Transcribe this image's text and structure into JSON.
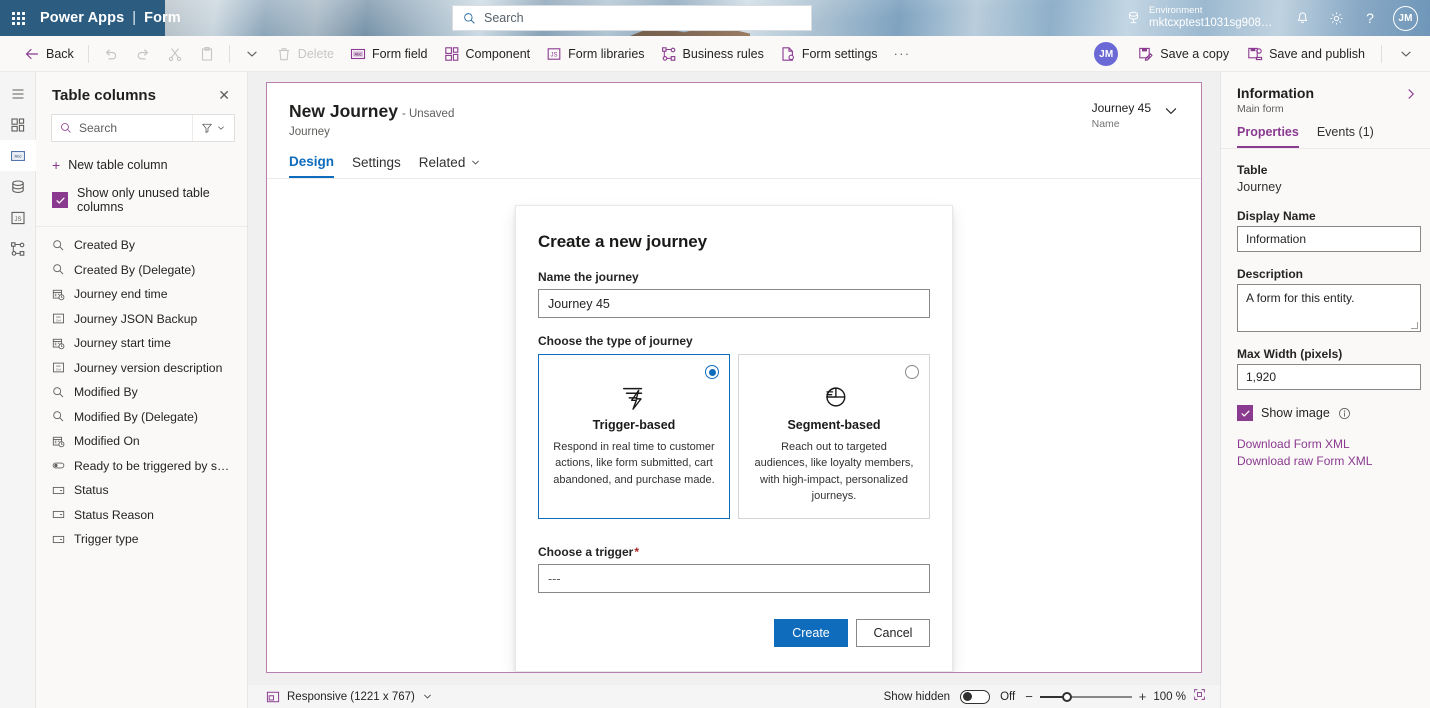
{
  "suitebar": {
    "waffle": "app-launcher",
    "brand": "Power Apps",
    "separator": "|",
    "app_name": "Form",
    "search_placeholder": "Search",
    "environment_label": "Environment",
    "environment_value": "mktcxptest1031sg908m...",
    "user_initials": "JM"
  },
  "commandbar": {
    "back": "Back",
    "delete": "Delete",
    "form_field": "Form field",
    "component": "Component",
    "form_libraries": "Form libraries",
    "business_rules": "Business rules",
    "form_settings": "Form settings",
    "overflow": "···",
    "user_initials": "JM",
    "save_a_copy": "Save a copy",
    "save_and_publish": "Save and publish"
  },
  "rail": {
    "items": [
      {
        "name": "hamburger-menu-icon"
      },
      {
        "name": "components-icon"
      },
      {
        "name": "table-columns-icon"
      },
      {
        "name": "data-sources-icon"
      },
      {
        "name": "form-libraries-icon"
      },
      {
        "name": "business-rules-icon"
      }
    ]
  },
  "left_panel": {
    "title": "Table columns",
    "close": "✕",
    "search_placeholder": "Search",
    "new_table_column": "New table column",
    "show_only_unused": "Show only unused table columns",
    "show_only_unused_checked": true,
    "columns": [
      {
        "label": "Created By",
        "icon": "lookup-icon"
      },
      {
        "label": "Created By (Delegate)",
        "icon": "lookup-icon"
      },
      {
        "label": "Journey end time",
        "icon": "datetime-icon"
      },
      {
        "label": "Journey JSON Backup",
        "icon": "multiline-text-icon"
      },
      {
        "label": "Journey start time",
        "icon": "datetime-icon"
      },
      {
        "label": "Journey version description",
        "icon": "multiline-text-icon"
      },
      {
        "label": "Modified By",
        "icon": "lookup-icon"
      },
      {
        "label": "Modified By (Delegate)",
        "icon": "lookup-icon"
      },
      {
        "label": "Modified On",
        "icon": "datetime-icon"
      },
      {
        "label": "Ready to be triggered by segment r...",
        "icon": "toggle-icon"
      },
      {
        "label": "Status",
        "icon": "choice-icon"
      },
      {
        "label": "Status Reason",
        "icon": "choice-icon"
      },
      {
        "label": "Trigger type",
        "icon": "choice-icon"
      }
    ]
  },
  "form_header": {
    "title": "New Journey",
    "unsaved": "- Unsaved",
    "table": "Journey",
    "record_value": "Journey 45",
    "record_label": "Name",
    "tabs": [
      {
        "label": "Design",
        "active": true,
        "chevron": false
      },
      {
        "label": "Settings",
        "active": false,
        "chevron": false
      },
      {
        "label": "Related",
        "active": false,
        "chevron": true
      }
    ]
  },
  "modal": {
    "heading": "Create a new journey",
    "name_label": "Name the journey",
    "name_value": "Journey 45",
    "type_label": "Choose the type of journey",
    "cards": [
      {
        "title": "Trigger-based",
        "description": "Respond in real time to customer actions, like form submitted, cart abandoned, and purchase made.",
        "selected": true,
        "icon": "trigger-bolt-icon"
      },
      {
        "title": "Segment-based",
        "description": "Reach out to targeted audiences, like loyalty members, with high-impact, personalized journeys.",
        "selected": false,
        "icon": "segment-pie-icon"
      }
    ],
    "trigger_label": "Choose a trigger",
    "trigger_required": "*",
    "trigger_value": "---",
    "create_button": "Create",
    "cancel_button": "Cancel"
  },
  "right_panel": {
    "title": "Information",
    "subtitle": "Main form",
    "tabs": [
      {
        "label": "Properties",
        "active": true
      },
      {
        "label": "Events (1)",
        "active": false
      }
    ],
    "table_label": "Table",
    "table_value": "Journey",
    "display_name_label": "Display Name",
    "display_name_value": "Information",
    "description_label": "Description",
    "description_value": "A form for this entity.",
    "max_width_label": "Max Width (pixels)",
    "max_width_value": "1,920",
    "show_image_label": "Show image",
    "show_image_checked": true,
    "download_form_xml": "Download Form XML",
    "download_raw_form_xml": "Download raw Form XML"
  },
  "statusbar": {
    "responsive": "Responsive (1221 x 767)",
    "show_hidden_label": "Show hidden",
    "show_hidden_state": "Off",
    "zoom_minus": "−",
    "zoom_plus": "+",
    "zoom_level": "100 %"
  },
  "colors": {
    "brand_purple": "#8a3a8f",
    "accent_blue": "#0f6cbd",
    "suite_blue": "#2c5d80",
    "required_red": "#a4262c"
  }
}
